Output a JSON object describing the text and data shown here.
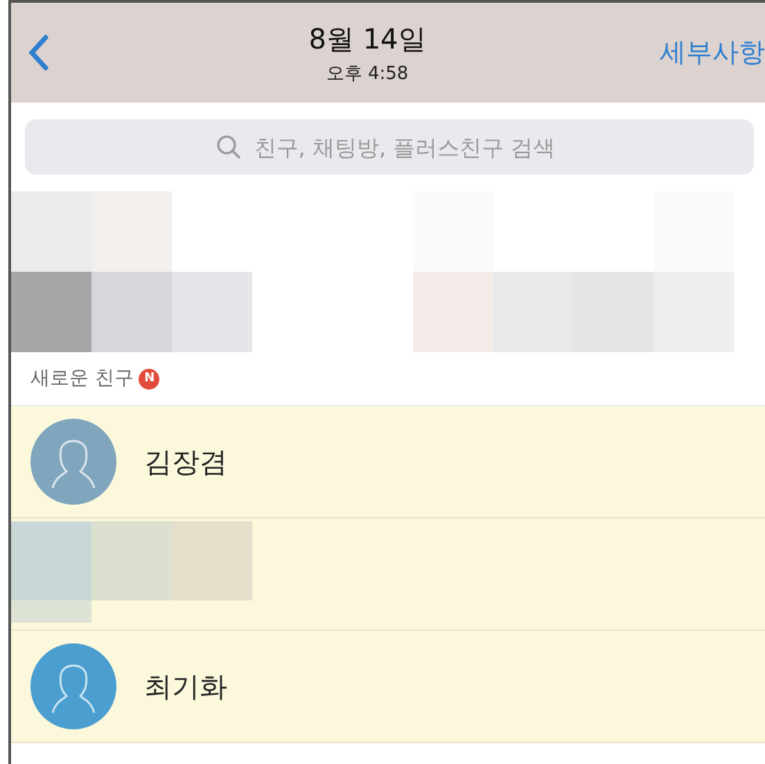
{
  "header": {
    "title": "8월 14일",
    "subtitle": "오후 4:58",
    "action": "세부사항"
  },
  "search": {
    "placeholder": "친구, 채팅방, 플러스친구 검색"
  },
  "section": {
    "label": "새로운 친구",
    "badge": "N"
  },
  "friends": [
    {
      "kind": "friend",
      "name": "김장겸",
      "color": "#7fa6bd"
    },
    {
      "kind": "hidden"
    },
    {
      "kind": "friend",
      "name": "최기화",
      "color": "#4a9fd0"
    }
  ]
}
